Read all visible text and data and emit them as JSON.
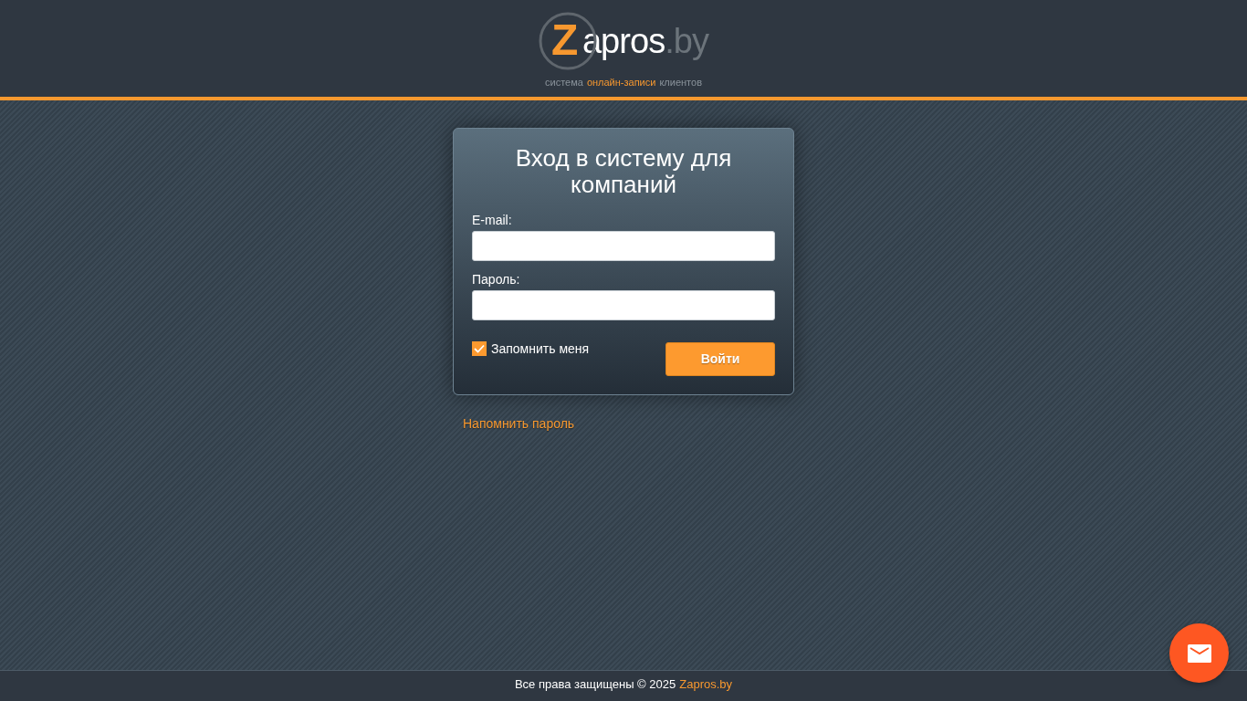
{
  "header": {
    "logo": {
      "initial": "Z",
      "name": "apros",
      "domain": ".by"
    },
    "tagline": [
      {
        "text": "система",
        "highlight": false
      },
      {
        "text": "онлайн-записи",
        "highlight": true
      },
      {
        "text": "клиентов",
        "highlight": false
      }
    ]
  },
  "login_form": {
    "title": "Вход в систему для компаний",
    "fields": [
      {
        "label": "E-mail:"
      },
      {
        "label": "Пароль:"
      }
    ],
    "remember": {
      "label": "Запомнить меня",
      "checked": true
    },
    "submit": "Войти"
  },
  "forgot_password": "Напомнить пароль",
  "footer": {
    "text": "Все права защищены © 2025",
    "link": "Zapros.by"
  }
}
